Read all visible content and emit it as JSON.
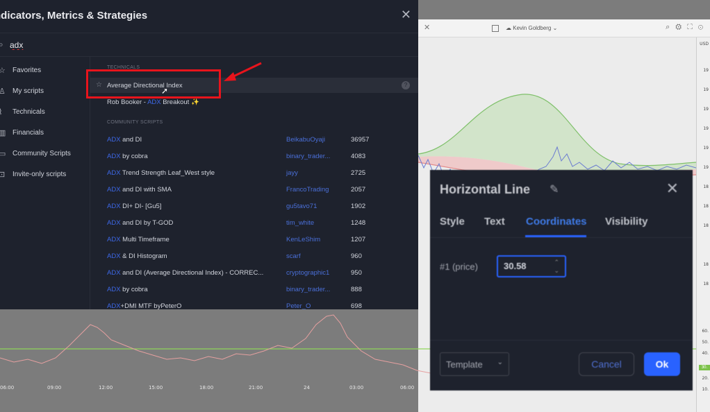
{
  "indicators_dialog": {
    "title": "ndicators, Metrics & Strategies",
    "close_icon": "close-icon",
    "search": {
      "value": "adx",
      "icon": "search-icon"
    },
    "sidebar": [
      {
        "label": "Favorites",
        "icon": "star-icon"
      },
      {
        "label": "My scripts",
        "icon": "user-icon"
      },
      {
        "label": "Technicals",
        "icon": "chart-icon"
      },
      {
        "label": "Financials",
        "icon": "bar-chart-icon"
      },
      {
        "label": "Community Scripts",
        "icon": "book-icon"
      },
      {
        "label": "Invite-only scripts",
        "icon": "lock-icon"
      }
    ],
    "technicals_header": "TECHNICALS",
    "technicals": [
      {
        "name": "Average Directional Index"
      },
      {
        "prefix": "Rob Booker - ",
        "adx": "ADX",
        "suffix": " Breakout"
      }
    ],
    "community_header": "COMMUNITY SCRIPTS",
    "community": [
      {
        "adx": "ADX",
        "rest": " and DI",
        "author": "BeikabuOyaji",
        "count": "36957"
      },
      {
        "adx": "ADX",
        "rest": " by cobra",
        "author": "binary_trader...",
        "count": "4083"
      },
      {
        "adx": "ADX",
        "rest": " Trend Strength Leaf_West style",
        "author": "jayy",
        "count": "2725"
      },
      {
        "adx": "ADX",
        "rest": " and DI with SMA",
        "author": "FrancoTrading",
        "count": "2057"
      },
      {
        "adx": "ADX",
        "rest": " DI+ DI- [Gu5]",
        "author": "gu5tavo71",
        "count": "1902"
      },
      {
        "adx": "ADX",
        "rest": " and DI by T-GOD",
        "author": "tim_white",
        "count": "1248"
      },
      {
        "adx": "ADX",
        "rest": " Multi Timeframe",
        "author": "KenLeShim",
        "count": "1207"
      },
      {
        "adx": "ADX",
        "rest": " & DI Histogram",
        "author": "scarf",
        "count": "960"
      },
      {
        "adx": "ADX",
        "rest": " and DI (Average Directional Index) - CORREC...",
        "author": "cryptographic1",
        "count": "950"
      },
      {
        "adx": "ADX",
        "rest": " by cobra",
        "author": "binary_trader...",
        "count": "888"
      },
      {
        "adx": "ADX",
        "rest": "+DMI MTF byPeterO",
        "author": "Peter_O",
        "count": "698"
      }
    ]
  },
  "chart_toolbar": {
    "user": "Kevin Goldberg"
  },
  "price_axis": {
    "currency": "USD",
    "ticks": [
      "19",
      "19",
      "19",
      "19",
      "19",
      "19",
      "18",
      "18",
      "18",
      "18",
      "18"
    ],
    "osc_ticks": [
      "60.",
      "50.",
      "40.",
      "30.",
      "20.",
      "10."
    ],
    "osc_badge": "30.",
    "badge_color": "#7cc24a"
  },
  "time_axis": [
    "06:00",
    "09:00",
    "12:00",
    "15:00",
    "18:00",
    "21:00",
    "24",
    "03:00",
    "06:00"
  ],
  "hline_dialog": {
    "title": "Horizontal Line",
    "tabs": [
      "Style",
      "Text",
      "Coordinates",
      "Visibility"
    ],
    "active_tab": "Coordinates",
    "field_label": "#1 (price)",
    "field_value": "30.58",
    "template_label": "Template",
    "cancel_label": "Cancel",
    "ok_label": "Ok"
  },
  "colors": {
    "accent": "#2962ff",
    "annotation": "#e8141c",
    "adx_link": "#3d68e8"
  }
}
